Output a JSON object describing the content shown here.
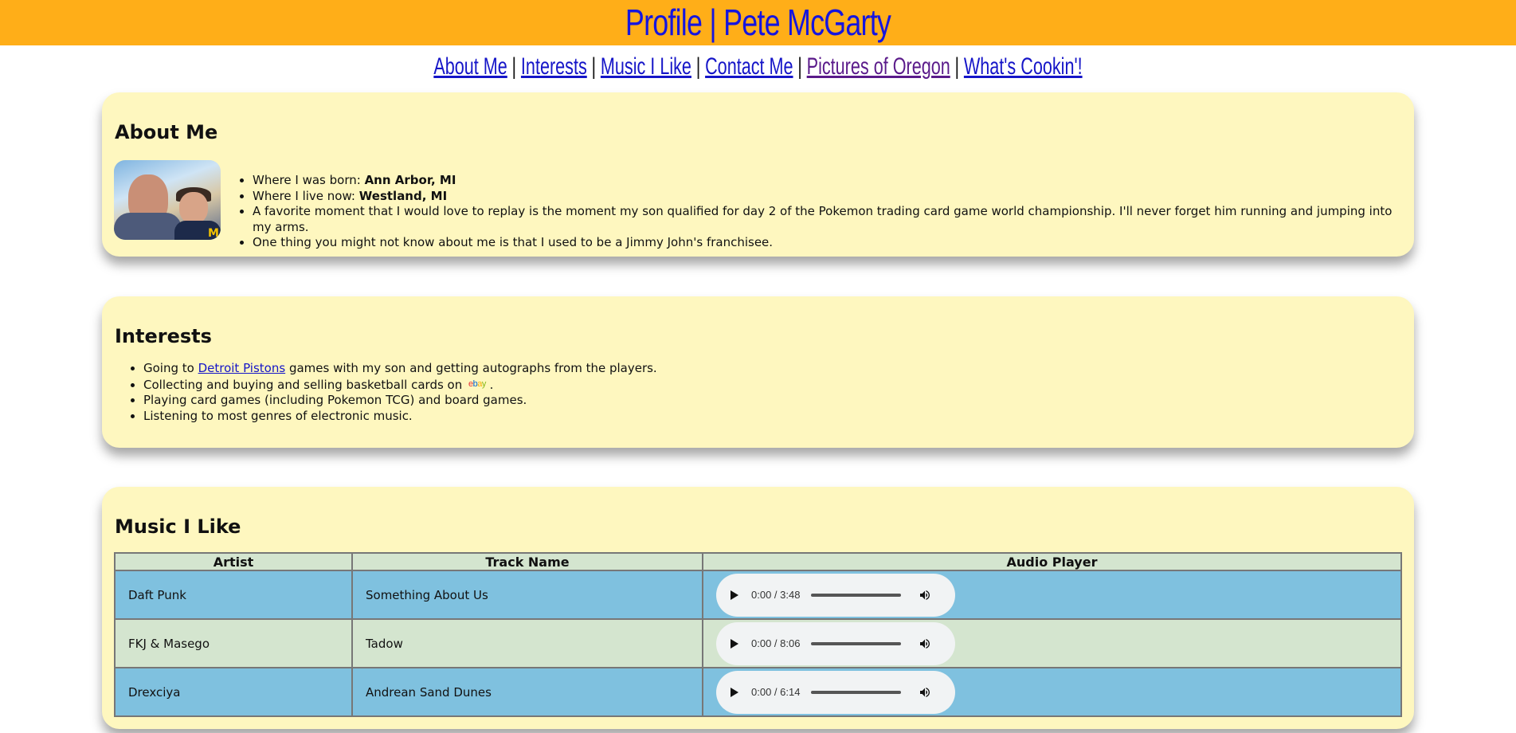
{
  "header": {
    "title": "Profile | Pete McGarty"
  },
  "nav": {
    "items": [
      {
        "label": "About Me"
      },
      {
        "label": "Interests"
      },
      {
        "label": "Music I Like"
      },
      {
        "label": "Contact Me"
      },
      {
        "label": "Pictures of Oregon"
      },
      {
        "label": "What's Cookin'!"
      }
    ],
    "separator": "|"
  },
  "about": {
    "heading": "About Me",
    "born_label": "Where I was born: ",
    "born_value": "Ann Arbor, MI",
    "live_label": "Where I live now: ",
    "live_value": "Westland, MI",
    "moment": "A favorite moment that I would love to replay is the moment my son qualified for day 2 of the Pokemon trading card game world championship. I'll never forget him running and jumping into my arms.",
    "fact": "One thing you might not know about me is that I used to be a Jimmy John's franchisee."
  },
  "interests": {
    "heading": "Interests",
    "item1_pre": "Going to ",
    "item1_link": "Detroit Pistons",
    "item1_post": " games with my son and getting autographs from the players.",
    "item2_pre": "Collecting and buying and selling basketball cards on ",
    "item2_logo": "ebay",
    "item2_post": ".",
    "item3": "Playing card games (including Pokemon TCG) and board games.",
    "item4": "Listening to most genres of electronic music."
  },
  "music": {
    "heading": "Music I Like",
    "columns": [
      "Artist",
      "Track Name",
      "Audio Player"
    ],
    "rows": [
      {
        "artist": "Daft Punk",
        "track": "Something About Us",
        "time": "0:00 / 3:48",
        "progress": 0
      },
      {
        "artist": "FKJ & Masego",
        "track": "Tadow",
        "time": "0:00 / 8:06",
        "progress": 0
      },
      {
        "artist": "Drexciya",
        "track": "Andrean Sand Dunes",
        "time": "0:00 / 6:14",
        "progress": 0
      }
    ]
  },
  "colors": {
    "banner": "#ffae18",
    "title": "#1515e0",
    "card": "#fef7bf",
    "row_blue": "#7fc1df",
    "row_green": "#d4e5cf"
  }
}
